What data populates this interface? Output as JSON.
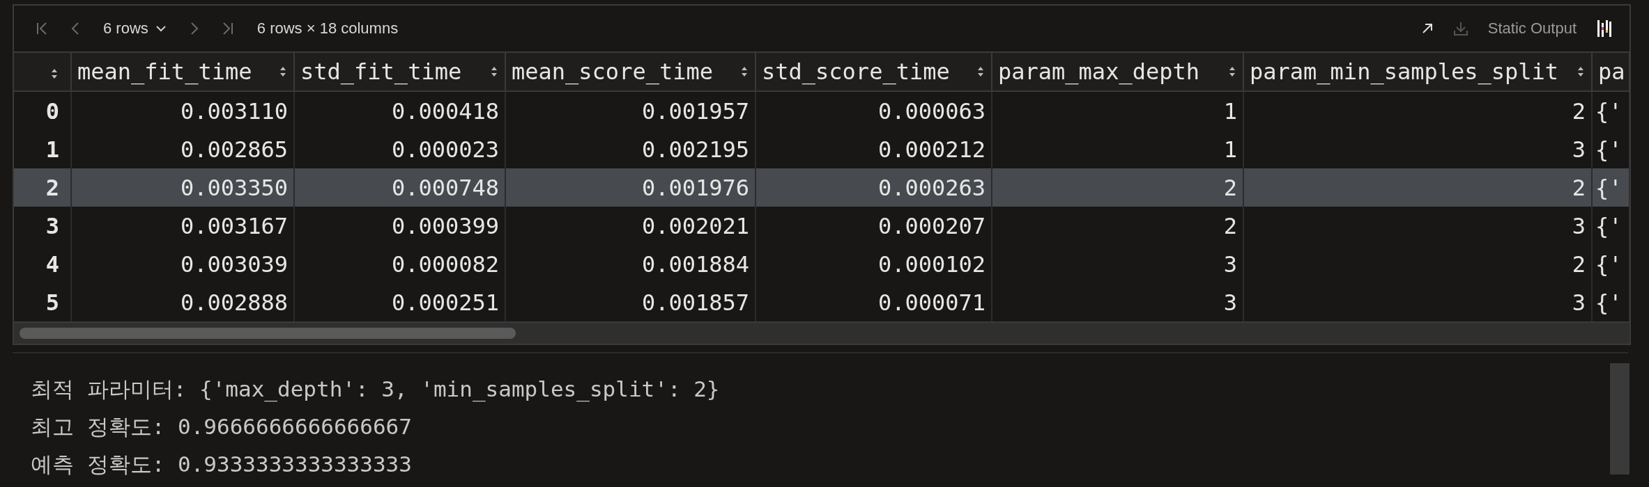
{
  "toolbar": {
    "page_size": "6 rows",
    "summary": "6 rows × 18 columns",
    "download_disabled": true,
    "output_mode": "Static Output"
  },
  "table": {
    "columns": [
      "mean_fit_time",
      "std_fit_time",
      "mean_score_time",
      "std_score_time",
      "param_max_depth",
      "param_min_samples_split",
      "pa"
    ],
    "rows": [
      {
        "index": "0",
        "selected": false,
        "cells": [
          "0.003110",
          "0.000418",
          "0.001957",
          "0.000063",
          "1",
          "2",
          "{'"
        ]
      },
      {
        "index": "1",
        "selected": false,
        "cells": [
          "0.002865",
          "0.000023",
          "0.002195",
          "0.000212",
          "1",
          "3",
          "{'"
        ]
      },
      {
        "index": "2",
        "selected": true,
        "cells": [
          "0.003350",
          "0.000748",
          "0.001976",
          "0.000263",
          "2",
          "2",
          "{'"
        ]
      },
      {
        "index": "3",
        "selected": false,
        "cells": [
          "0.003167",
          "0.000399",
          "0.002021",
          "0.000207",
          "2",
          "3",
          "{'"
        ]
      },
      {
        "index": "4",
        "selected": false,
        "cells": [
          "0.003039",
          "0.000082",
          "0.001884",
          "0.000102",
          "3",
          "2",
          "{'"
        ]
      },
      {
        "index": "5",
        "selected": false,
        "cells": [
          "0.002888",
          "0.000251",
          "0.001857",
          "0.000071",
          "3",
          "3",
          "{'"
        ]
      }
    ]
  },
  "output": [
    "최적 파라미터: {'max_depth': 3, 'min_samples_split': 2}",
    "최고 정확도: 0.9666666666666667",
    "예측 정확도: 0.9333333333333333"
  ]
}
